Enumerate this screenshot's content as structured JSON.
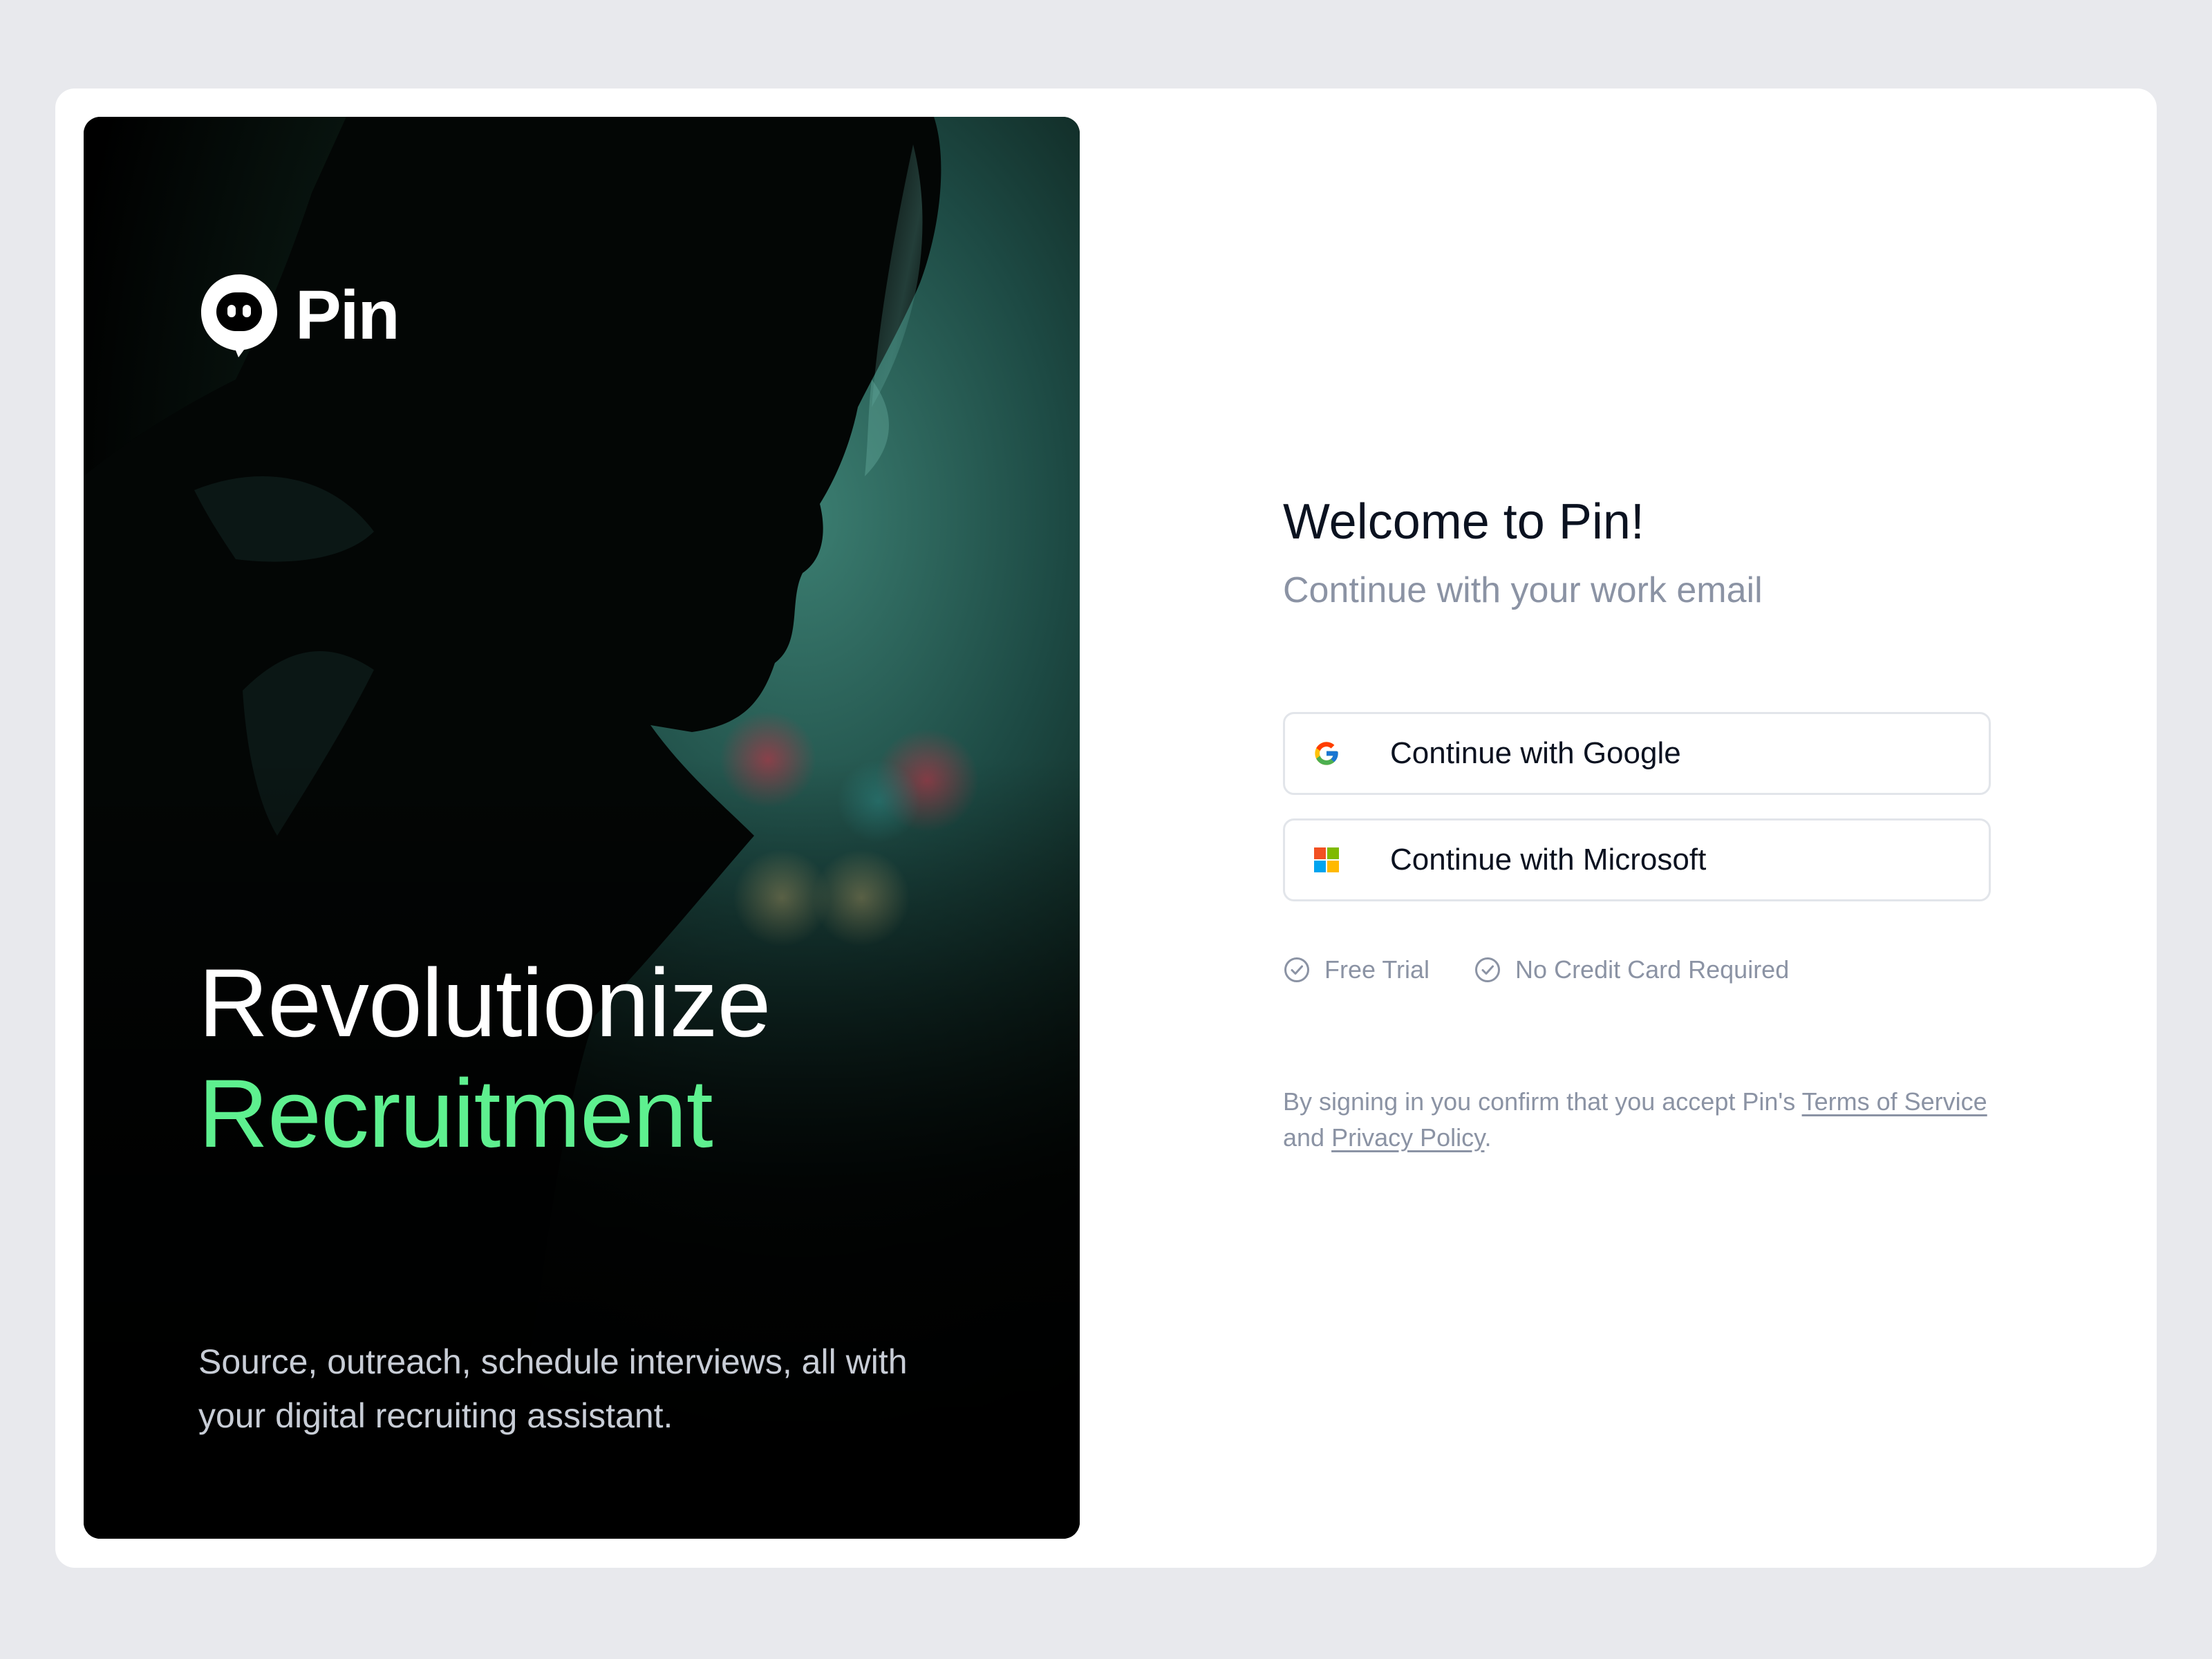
{
  "brand": {
    "name": "Pin"
  },
  "hero": {
    "headline_line1": "Revolutionize",
    "headline_line2": "Recruitment",
    "tagline": "Source, outreach, schedule interviews, all with your digital recruiting assistant.",
    "accent_color": "#5ef08f"
  },
  "form": {
    "title": "Welcome to Pin!",
    "subtitle": "Continue with your work email",
    "buttons": [
      {
        "label": "Continue with Google",
        "icon": "google-icon"
      },
      {
        "label": "Continue with Microsoft",
        "icon": "microsoft-icon"
      }
    ],
    "perks": [
      {
        "label": "Free Trial",
        "icon": "check-circle-icon"
      },
      {
        "label": "No Credit Card Required",
        "icon": "check-circle-icon"
      }
    ],
    "legal": {
      "prefix": "By signing in you confirm that you accept Pin's ",
      "terms_link": "Terms of Service",
      "middle": " and ",
      "privacy_link": "Privacy Policy",
      "suffix": "."
    }
  }
}
